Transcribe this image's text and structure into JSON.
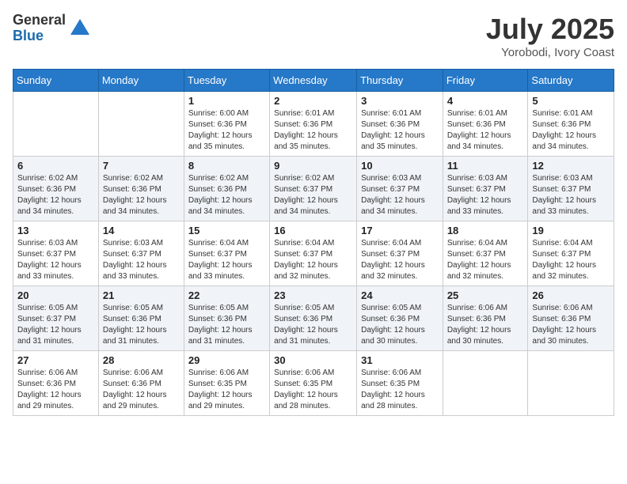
{
  "header": {
    "logo_general": "General",
    "logo_blue": "Blue",
    "month_year": "July 2025",
    "location": "Yorobodi, Ivory Coast"
  },
  "weekdays": [
    "Sunday",
    "Monday",
    "Tuesday",
    "Wednesday",
    "Thursday",
    "Friday",
    "Saturday"
  ],
  "weeks": [
    [
      {
        "day": "",
        "sunrise": "",
        "sunset": "",
        "daylight": ""
      },
      {
        "day": "",
        "sunrise": "",
        "sunset": "",
        "daylight": ""
      },
      {
        "day": "1",
        "sunrise": "Sunrise: 6:00 AM",
        "sunset": "Sunset: 6:36 PM",
        "daylight": "Daylight: 12 hours and 35 minutes."
      },
      {
        "day": "2",
        "sunrise": "Sunrise: 6:01 AM",
        "sunset": "Sunset: 6:36 PM",
        "daylight": "Daylight: 12 hours and 35 minutes."
      },
      {
        "day": "3",
        "sunrise": "Sunrise: 6:01 AM",
        "sunset": "Sunset: 6:36 PM",
        "daylight": "Daylight: 12 hours and 35 minutes."
      },
      {
        "day": "4",
        "sunrise": "Sunrise: 6:01 AM",
        "sunset": "Sunset: 6:36 PM",
        "daylight": "Daylight: 12 hours and 34 minutes."
      },
      {
        "day": "5",
        "sunrise": "Sunrise: 6:01 AM",
        "sunset": "Sunset: 6:36 PM",
        "daylight": "Daylight: 12 hours and 34 minutes."
      }
    ],
    [
      {
        "day": "6",
        "sunrise": "Sunrise: 6:02 AM",
        "sunset": "Sunset: 6:36 PM",
        "daylight": "Daylight: 12 hours and 34 minutes."
      },
      {
        "day": "7",
        "sunrise": "Sunrise: 6:02 AM",
        "sunset": "Sunset: 6:36 PM",
        "daylight": "Daylight: 12 hours and 34 minutes."
      },
      {
        "day": "8",
        "sunrise": "Sunrise: 6:02 AM",
        "sunset": "Sunset: 6:36 PM",
        "daylight": "Daylight: 12 hours and 34 minutes."
      },
      {
        "day": "9",
        "sunrise": "Sunrise: 6:02 AM",
        "sunset": "Sunset: 6:37 PM",
        "daylight": "Daylight: 12 hours and 34 minutes."
      },
      {
        "day": "10",
        "sunrise": "Sunrise: 6:03 AM",
        "sunset": "Sunset: 6:37 PM",
        "daylight": "Daylight: 12 hours and 34 minutes."
      },
      {
        "day": "11",
        "sunrise": "Sunrise: 6:03 AM",
        "sunset": "Sunset: 6:37 PM",
        "daylight": "Daylight: 12 hours and 33 minutes."
      },
      {
        "day": "12",
        "sunrise": "Sunrise: 6:03 AM",
        "sunset": "Sunset: 6:37 PM",
        "daylight": "Daylight: 12 hours and 33 minutes."
      }
    ],
    [
      {
        "day": "13",
        "sunrise": "Sunrise: 6:03 AM",
        "sunset": "Sunset: 6:37 PM",
        "daylight": "Daylight: 12 hours and 33 minutes."
      },
      {
        "day": "14",
        "sunrise": "Sunrise: 6:03 AM",
        "sunset": "Sunset: 6:37 PM",
        "daylight": "Daylight: 12 hours and 33 minutes."
      },
      {
        "day": "15",
        "sunrise": "Sunrise: 6:04 AM",
        "sunset": "Sunset: 6:37 PM",
        "daylight": "Daylight: 12 hours and 33 minutes."
      },
      {
        "day": "16",
        "sunrise": "Sunrise: 6:04 AM",
        "sunset": "Sunset: 6:37 PM",
        "daylight": "Daylight: 12 hours and 32 minutes."
      },
      {
        "day": "17",
        "sunrise": "Sunrise: 6:04 AM",
        "sunset": "Sunset: 6:37 PM",
        "daylight": "Daylight: 12 hours and 32 minutes."
      },
      {
        "day": "18",
        "sunrise": "Sunrise: 6:04 AM",
        "sunset": "Sunset: 6:37 PM",
        "daylight": "Daylight: 12 hours and 32 minutes."
      },
      {
        "day": "19",
        "sunrise": "Sunrise: 6:04 AM",
        "sunset": "Sunset: 6:37 PM",
        "daylight": "Daylight: 12 hours and 32 minutes."
      }
    ],
    [
      {
        "day": "20",
        "sunrise": "Sunrise: 6:05 AM",
        "sunset": "Sunset: 6:37 PM",
        "daylight": "Daylight: 12 hours and 31 minutes."
      },
      {
        "day": "21",
        "sunrise": "Sunrise: 6:05 AM",
        "sunset": "Sunset: 6:36 PM",
        "daylight": "Daylight: 12 hours and 31 minutes."
      },
      {
        "day": "22",
        "sunrise": "Sunrise: 6:05 AM",
        "sunset": "Sunset: 6:36 PM",
        "daylight": "Daylight: 12 hours and 31 minutes."
      },
      {
        "day": "23",
        "sunrise": "Sunrise: 6:05 AM",
        "sunset": "Sunset: 6:36 PM",
        "daylight": "Daylight: 12 hours and 31 minutes."
      },
      {
        "day": "24",
        "sunrise": "Sunrise: 6:05 AM",
        "sunset": "Sunset: 6:36 PM",
        "daylight": "Daylight: 12 hours and 30 minutes."
      },
      {
        "day": "25",
        "sunrise": "Sunrise: 6:06 AM",
        "sunset": "Sunset: 6:36 PM",
        "daylight": "Daylight: 12 hours and 30 minutes."
      },
      {
        "day": "26",
        "sunrise": "Sunrise: 6:06 AM",
        "sunset": "Sunset: 6:36 PM",
        "daylight": "Daylight: 12 hours and 30 minutes."
      }
    ],
    [
      {
        "day": "27",
        "sunrise": "Sunrise: 6:06 AM",
        "sunset": "Sunset: 6:36 PM",
        "daylight": "Daylight: 12 hours and 29 minutes."
      },
      {
        "day": "28",
        "sunrise": "Sunrise: 6:06 AM",
        "sunset": "Sunset: 6:36 PM",
        "daylight": "Daylight: 12 hours and 29 minutes."
      },
      {
        "day": "29",
        "sunrise": "Sunrise: 6:06 AM",
        "sunset": "Sunset: 6:35 PM",
        "daylight": "Daylight: 12 hours and 29 minutes."
      },
      {
        "day": "30",
        "sunrise": "Sunrise: 6:06 AM",
        "sunset": "Sunset: 6:35 PM",
        "daylight": "Daylight: 12 hours and 28 minutes."
      },
      {
        "day": "31",
        "sunrise": "Sunrise: 6:06 AM",
        "sunset": "Sunset: 6:35 PM",
        "daylight": "Daylight: 12 hours and 28 minutes."
      },
      {
        "day": "",
        "sunrise": "",
        "sunset": "",
        "daylight": ""
      },
      {
        "day": "",
        "sunrise": "",
        "sunset": "",
        "daylight": ""
      }
    ]
  ]
}
